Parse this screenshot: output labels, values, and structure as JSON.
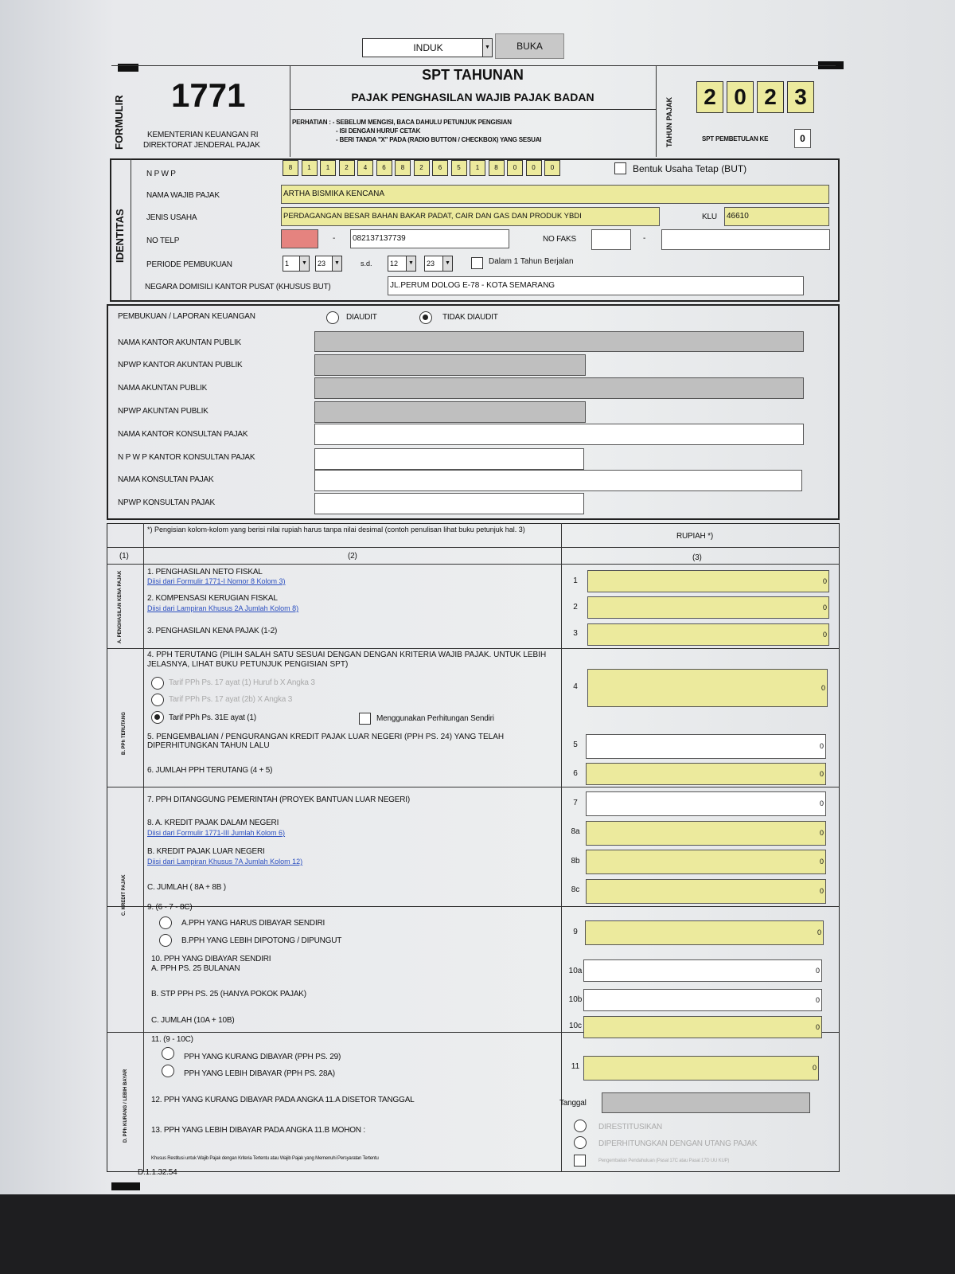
{
  "controls": {
    "dropdown_value": "INDUK",
    "open_label": "BUKA"
  },
  "header": {
    "form_label": "FORMULIR",
    "form_number": "1771",
    "ministry": "KEMENTERIAN KEUANGAN RI",
    "directorate": "DIREKTORAT JENDERAL PAJAK",
    "title": "SPT TAHUNAN",
    "subtitle": "PAJAK PENGHASILAN WAJIB PAJAK BADAN",
    "notice1": "PERHATIAN : - SEBELUM MENGISI, BACA DAHULU PETUNJUK PENGISIAN",
    "notice2": "- ISI DENGAN HURUF CETAK",
    "notice3": "- BERI TANDA \"X\" PADA (RADIO BUTTON / CHECKBOX) YANG SESUAI",
    "tax_year_label": "TAHUN PAJAK",
    "year": [
      "2",
      "0",
      "2",
      "3"
    ],
    "amendment_label": "SPT PEMBETULAN KE",
    "amendment_value": "0"
  },
  "identity": {
    "section_label": "IDENTITAS",
    "npwp_label": "N P W P",
    "npwp_digits": [
      "8",
      "1",
      "1",
      "2",
      "4",
      "6",
      "8",
      "2",
      "6",
      "5",
      "1",
      "8",
      "0",
      "0",
      "0"
    ],
    "but_label": "Bentuk Usaha Tetap (BUT)",
    "name_label": "NAMA WAJIB PAJAK",
    "name_value": "ARTHA BISMIKA KENCANA",
    "business_label": "JENIS USAHA",
    "business_value": "PERDAGANGAN BESAR BAHAN BAKAR PADAT, CAIR DAN GAS DAN PRODUK YBDI",
    "klu_label": "KLU",
    "klu_value": "46610",
    "phone_label": "NO TELP",
    "separator": "-",
    "phone_value": "082137137739",
    "fax_label": "NO FAKS",
    "period_label": "PERIODE PEMBUKUAN",
    "period": [
      "1",
      "23",
      "12",
      "23"
    ],
    "period_to": "s.d.",
    "within_year": "Dalam 1 Tahun Berjalan",
    "country_label": "NEGARA DOMISILI KANTOR PUSAT (khusus BUT)",
    "country_value": "JL.PERUM DOLOG E-78 - KOTA SEMARANG"
  },
  "audit": {
    "report_label": "PEMBUKUAN / LAPORAN KEUANGAN",
    "audited": "DIAUDIT",
    "not_audited": "TIDAK DIAUDIT",
    "rows": [
      "NAMA KANTOR AKUNTAN PUBLIK",
      "NPWP KANTOR AKUNTAN PUBLIK",
      "NAMA AKUNTAN PUBLIK",
      "NPWP AKUNTAN PUBLIK",
      "NAMA KANTOR KONSULTAN PAJAK",
      "N P W P KANTOR KONSULTAN PAJAK",
      "NAMA KONSULTAN PAJAK",
      "NPWP KONSULTAN PAJAK"
    ]
  },
  "table": {
    "note": "*) Pengisian kolom-kolom yang berisi nilai rupiah harus tanpa nilai desimal (contoh penulisan lihat buku petunjuk hal. 3)",
    "rupiah": "RUPIAH *)",
    "col1": "(1)",
    "col2": "(2)",
    "col3": "(3)",
    "sec_a": "A. PENGHASILAN KENA PAJAK",
    "sec_b": "B. PPh TERUTANG",
    "sec_c": "C. KREDIT PAJAK",
    "sec_d": "D. PPh KURANG / LEBIH BAYAR",
    "r1": "1. PENGHASILAN NETO FISKAL",
    "r1_link": "Diisi dari Formulir 1771-I Nomor 8 Kolom 3)",
    "n1": "1",
    "v1": "0",
    "r2": "2. KOMPENSASI KERUGIAN FISKAL",
    "r2_link": "Diisi dari Lampiran Khusus 2A Jumlah Kolom 8)",
    "n2": "2",
    "v2": "0",
    "r3": "3. PENGHASILAN KENA PAJAK (1-2)",
    "n3": "3",
    "v3": "0",
    "r4": "4. PPh TERUTANG (Pilih salah satu sesuai dengan dengan kriteria Wajib Pajak. Untuk lebih jelasnya, lihat Buku Petunjuk Pengisian SPT)",
    "opt1": "Tarif PPh Ps. 17 ayat (1) Huruf b X Angka 3",
    "opt2": "Tarif PPh Ps. 17 ayat (2b) X Angka 3",
    "opt3": "Tarif PPh Ps. 31E ayat (1)",
    "own_calc": "Menggunakan Perhitungan Sendiri",
    "n4": "4",
    "v4": "0",
    "r5": "5. PENGEMBALIAN / PENGURANGAN KREDIT PAJAK LUAR NEGERI (PPh Ps. 24) YANG TELAH DIPERHITUNGKAN TAHUN LALU",
    "n5": "5",
    "v5": "0",
    "r6": "6. JUMLAH PPh TERUTANG (4 + 5)",
    "n6": "6",
    "v6": "0",
    "r7": "7. PPh DITANGGUNG PEMERINTAH (Proyek Bantuan Luar Negeri)",
    "n7": "7",
    "v7": "0",
    "r8a": "8. a. KREDIT PAJAK DALAM NEGERI",
    "r8a_link": "Diisi dari Formulir 1771-III Jumlah Kolom 6)",
    "n8a": "8a",
    "v8a": "0",
    "r8b": "b. KREDIT PAJAK LUAR NEGERI",
    "r8b_link": "Diisi dari Lampiran Khusus 7A Jumlah Kolom 12)",
    "n8b": "8b",
    "v8b": "0",
    "r8c": "c. JUMLAH ( 8a + 8b )",
    "n8c": "8c",
    "v8c": "0",
    "r9": "9. (6 - 7 - 8c)",
    "r9a": "a.PPh YANG HARUS DIBAYAR SENDIRI",
    "r9b": "b.PPh YANG LEBIH DIPOTONG / DIPUNGUT",
    "n9": "9",
    "v9": "0",
    "r10": "10. PPh YANG DIBAYAR SENDIRI",
    "r10a": "a. PPh Ps. 25 BULANAN",
    "n10a": "10a",
    "v10a": "0",
    "r10b": "b. STP PPh Ps. 25 (Hanya Pokok Pajak)",
    "n10b": "10b",
    "v10b": "0",
    "r10c": "c. JUMLAH (10a + 10b)",
    "n10c": "10c",
    "v10c": "0",
    "r11": "11. (9 - 10c)",
    "r11a": "PPh YANG KURANG DIBAYAR (PPh Ps. 29)",
    "r11b": "PPh YANG LEBIH DIBAYAR (PPh Ps. 28A)",
    "n11": "11",
    "v11": "0",
    "r12": "12. PPh YANG KURANG DIBAYAR PADA ANGKA 11.a DISETOR TANGGAL",
    "date_label": "Tanggal",
    "r13": "13. PPh YANG LEBIH DIBAYAR PADA ANGKA 11.b MOHON :",
    "refund": "DIRESTITUSIKAN",
    "offset": "DIPERHITUNGKAN DENGAN UTANG PAJAK",
    "special": "Khusus Restitusi untuk Wajib Pajak dengan Kriteria Tertentu atau Wajib Pajak yang Memenuhi Persyaratan Tertentu",
    "special_detail": "Pengembalian Pendahuluan (Pasal 17C atau Pasal 17D UU KUP)"
  },
  "footer": {
    "code": "D.1.1.32.54"
  },
  "colors": {
    "input_yellow": "#ecea9d",
    "readonly_gray": "#bfbfbf",
    "phone_highlight": "#e5837f",
    "link_blue": "#2b4fc0"
  }
}
